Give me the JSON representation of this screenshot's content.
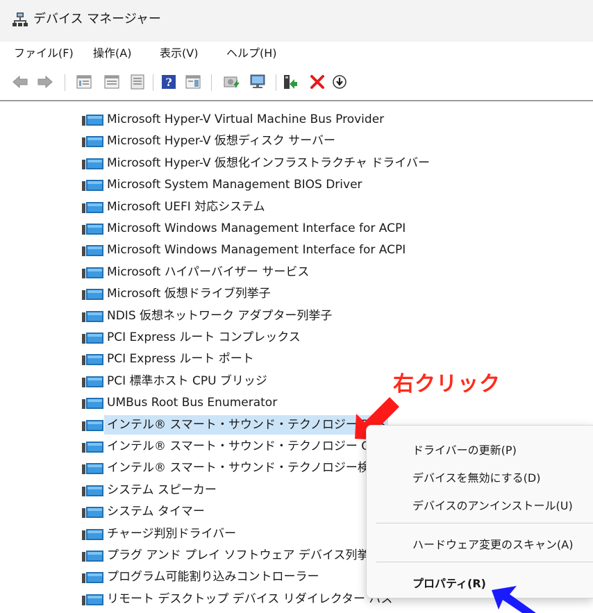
{
  "window": {
    "title": "デバイス マネージャー",
    "icon": "device-manager-icon"
  },
  "menu": [
    "ファイル(F)",
    "操作(A)",
    "表示(V)",
    "ヘルプ(H)"
  ],
  "toolbar": [
    "back-arrow-icon",
    "forward-arrow-icon",
    "show-hide-tree-icon",
    "properties-icon",
    "help-icon",
    "action-pane-icon",
    "update-driver-icon",
    "scan-hardware-icon",
    "add-driver-icon",
    "uninstall-x-icon",
    "download-circle-icon"
  ],
  "devices": [
    "Microsoft Hyper-V Virtual Machine Bus Provider",
    "Microsoft Hyper-V 仮想ディスク サーバー",
    "Microsoft Hyper-V 仮想化インフラストラクチャ ドライバー",
    "Microsoft System Management BIOS Driver",
    "Microsoft UEFI 対応システム",
    "Microsoft Windows Management Interface for ACPI",
    "Microsoft Windows Management Interface for ACPI",
    "Microsoft ハイパーバイザー サービス",
    "Microsoft 仮想ドライブ列挙子",
    "NDIS 仮想ネットワーク アダプター列挙子",
    "PCI Express ルート コンプレックス",
    "PCI Express ルート ポート",
    "PCI 標準ホスト CPU ブリッジ",
    "UMBus Root Bus Enumerator",
    "インテル® スマート・サウンド・テクノロジー BUS",
    "インテル® スマート・サウンド・テクノロジー OED",
    "インテル® スマート・サウンド・テクノロジー検出器",
    "システム スピーカー",
    "システム タイマー",
    "チャージ判別ドライバー",
    "プラグ アンド プレイ ソフトウェア デバイス列挙子",
    "プログラム可能割り込みコントローラー",
    "リモート デスクトップ デバイス リダイレクター バス"
  ],
  "selected_device_index": 14,
  "annotation": {
    "text": "右クリック",
    "color": "#ff2a1a",
    "pointer_color": "#1a1aff"
  },
  "context_menu": {
    "items": [
      {
        "label": "ドライバーの更新(P)",
        "bold": false
      },
      {
        "label": "デバイスを無効にする(D)",
        "bold": false
      },
      {
        "label": "デバイスのアンインストール(U)",
        "bold": false
      },
      {
        "label": "ハードウェア変更のスキャン(A)",
        "bold": false
      },
      {
        "label": "プロパティ(R)",
        "bold": true
      }
    ]
  },
  "colors": {
    "selection": "#cce4f7",
    "menu_bg": "#f9f9f9"
  }
}
